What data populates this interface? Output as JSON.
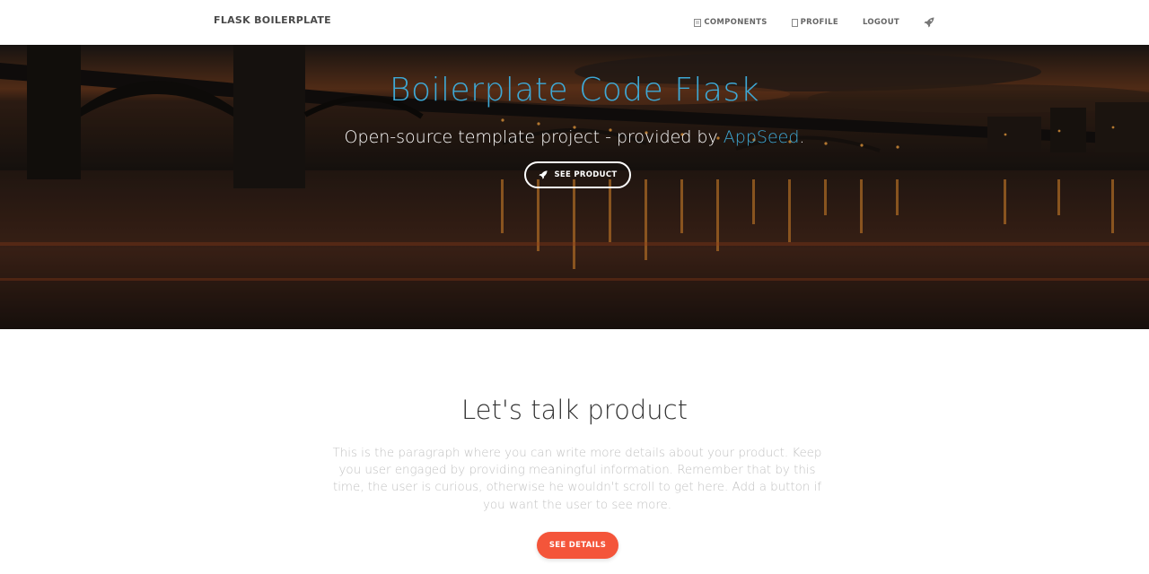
{
  "navbar": {
    "brand": "FLASK BOILERPLATE",
    "links": [
      {
        "label": "COMPONENTS",
        "icon": "components-icon"
      },
      {
        "label": "PROFILE",
        "icon": "profile-icon"
      },
      {
        "label": "LOGOUT",
        "icon": ""
      },
      {
        "label": "",
        "icon": "rocket-icon"
      }
    ]
  },
  "hero": {
    "title": "Boilerplate Code Flask",
    "subtitle_prefix": "Open-source template project - provided by ",
    "subtitle_link": "AppSeed",
    "subtitle_suffix": ".",
    "button_label": "SEE PRODUCT",
    "button_icon": "rocket-icon"
  },
  "content": {
    "title": "Let's talk product",
    "paragraph": "This is the paragraph where you can write more details about your product. Keep you user engaged by providing meaningful information. Remember that by this time, the user is curious, otherwise he wouldn't scroll to get here. Add a button if you want the user to see more.",
    "button_label": "SEE DETAILS"
  },
  "colors": {
    "accent_blue": "#3ea9d6",
    "accent_orange": "#f4553a",
    "nav_text": "#666666"
  }
}
